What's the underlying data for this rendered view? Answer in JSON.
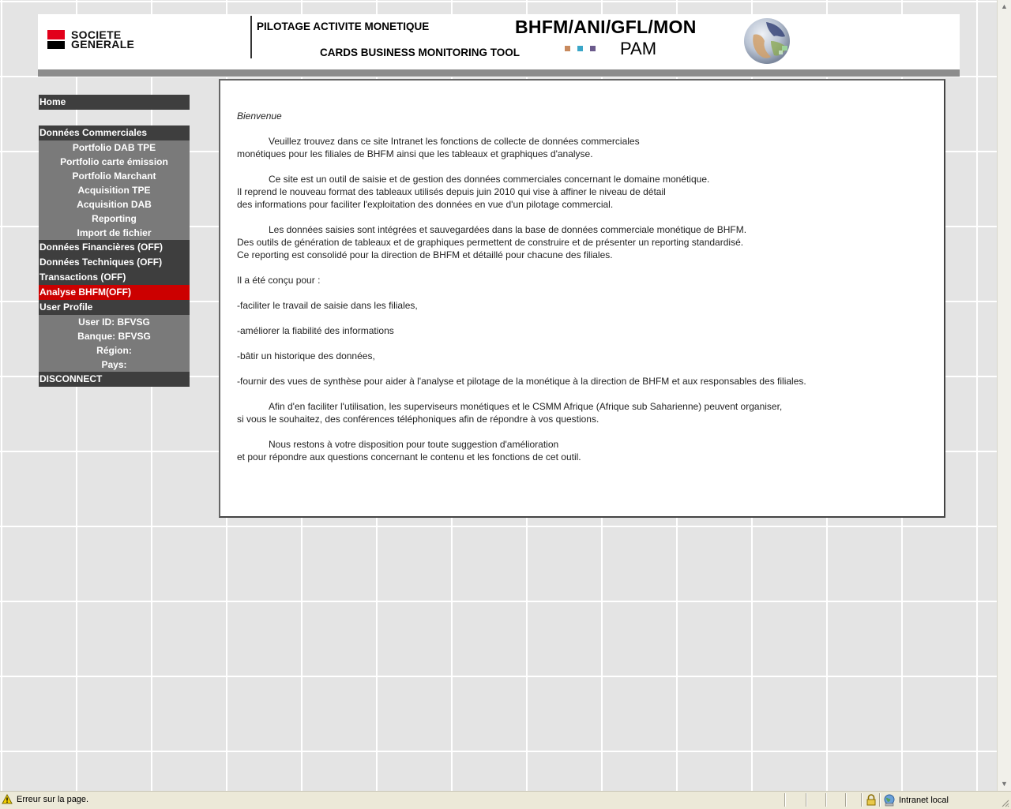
{
  "header": {
    "logo_line1": "SOCIETE",
    "logo_line2": "GENERALE",
    "title_fr": "PILOTAGE ACTIVITE MONETIQUE",
    "title_en": "CARDS BUSINESS MONITORING TOOL",
    "department_code": "BHFM/ANI/GFL/MON",
    "app_short_name": "PAM",
    "dot_colors": [
      "#c88a5e",
      "#3aa6c8",
      "#6b5a8c"
    ],
    "globe_icon": "globe-icon"
  },
  "sidebar": {
    "home": "Home",
    "donnees_commerciales": "Données Commerciales",
    "commercial_items": [
      "Portfolio DAB TPE",
      "Portfolio carte émission",
      "Portfolio Marchant",
      "Acquisition TPE",
      "Acquisition DAB",
      "Reporting",
      "Import de fichier"
    ],
    "donnees_financieres": "Données Financières (OFF)",
    "donnees_techniques": "Données Techniques (OFF)",
    "transactions": "Transactions (OFF)",
    "analyse": "Analyse BHFM(OFF)",
    "user_profile": "User Profile",
    "user_id": "User ID: BFVSG",
    "banque": "Banque: BFVSG",
    "region": "Région:",
    "pays": "Pays:",
    "disconnect": "DISCONNECT",
    "active_color": "#cc0000"
  },
  "content": {
    "welcome": "Bienvenue",
    "p1_l1": "Veuillez trouvez dans ce site Intranet les fonctions de collecte de données commerciales",
    "p1_l2": "monétiques pour les filiales de BHFM ainsi que les tableaux et graphiques d'analyse.",
    "p2_l1": "Ce site est un outil de saisie et de gestion des données commerciales concernant le domaine monétique.",
    "p2_l2": "Il reprend le nouveau format des tableaux utilisés depuis juin 2010 qui vise à affiner le niveau de détail",
    "p2_l3": "des informations pour faciliter l'exploitation des données en vue d'un pilotage commercial.",
    "p3_l1": "Les données saisies sont intégrées et sauvegardées dans la base de données commerciale monétique de BHFM.",
    "p3_l2": "Des outils de génération de tableaux et de graphiques permettent de construire et de présenter un reporting standardisé.",
    "p3_l3": "Ce reporting est consolidé pour la direction de BHFM et détaillé pour chacune des filiales.",
    "p4": "Il a été conçu pour :",
    "b1": "-faciliter le travail de saisie dans les filiales,",
    "b2": "-améliorer la fiabilité des informations",
    "b3": "-bâtir un historique des données,",
    "b4": "-fournir des vues de synthèse pour aider à l'analyse et pilotage de la monétique à la direction de BHFM et aux responsables des filiales.",
    "p5_l1": "Afin d'en faciliter l'utilisation, les superviseurs monétiques et le CSMM Afrique (Afrique sub Saharienne) peuvent organiser,",
    "p5_l2": "si vous le souhaitez, des conférences téléphoniques afin de répondre à vos questions.",
    "p6_l1": "Nous restons à votre disposition pour toute suggestion d'amélioration",
    "p6_l2": "et pour répondre aux questions concernant le contenu et les fonctions de cet outil."
  },
  "statusbar": {
    "message": "Erreur sur la page.",
    "zone": "Intranet local",
    "warning_icon": "warning-icon",
    "lock_icon": "lock-icon",
    "zone_icon": "intranet-zone-icon"
  }
}
